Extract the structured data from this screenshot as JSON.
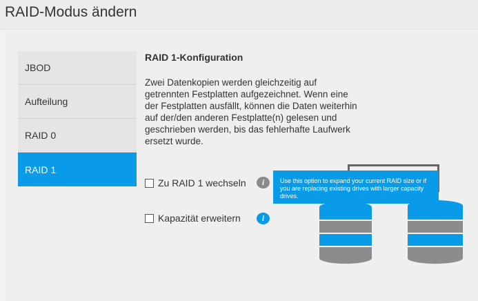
{
  "header": {
    "title": "RAID-Modus ändern"
  },
  "nav": {
    "items": [
      {
        "label": "JBOD",
        "active": false
      },
      {
        "label": "Aufteilung",
        "active": false
      },
      {
        "label": "RAID 0",
        "active": false
      },
      {
        "label": "RAID 1",
        "active": true
      }
    ]
  },
  "content": {
    "title": "RAID 1-Konfiguration",
    "description": "Zwei Datenkopien werden gleichzeitig auf getrennten Festplatten aufgezeichnet. Wenn eine der Festplatten ausfällt, können die Daten weiterhin auf der/den anderen Festplatte(n) gelesen und geschrieben werden, bis das fehlerhafte Laufwerk ersetzt wurde.",
    "options": [
      {
        "label": "Zu RAID 1 wechseln",
        "checked": false,
        "info_icon": "info-icon"
      },
      {
        "label": "Kapazität erweitern",
        "checked": false,
        "info_icon": "info-icon"
      }
    ],
    "tooltip": "Use this option to expand your current RAID size or if you are replacing existing drives with larger capacity drives."
  },
  "colors": {
    "accent": "#0a9be8",
    "disk_gray": "#8c8c8c",
    "disk_blue": "#0a9be8"
  }
}
